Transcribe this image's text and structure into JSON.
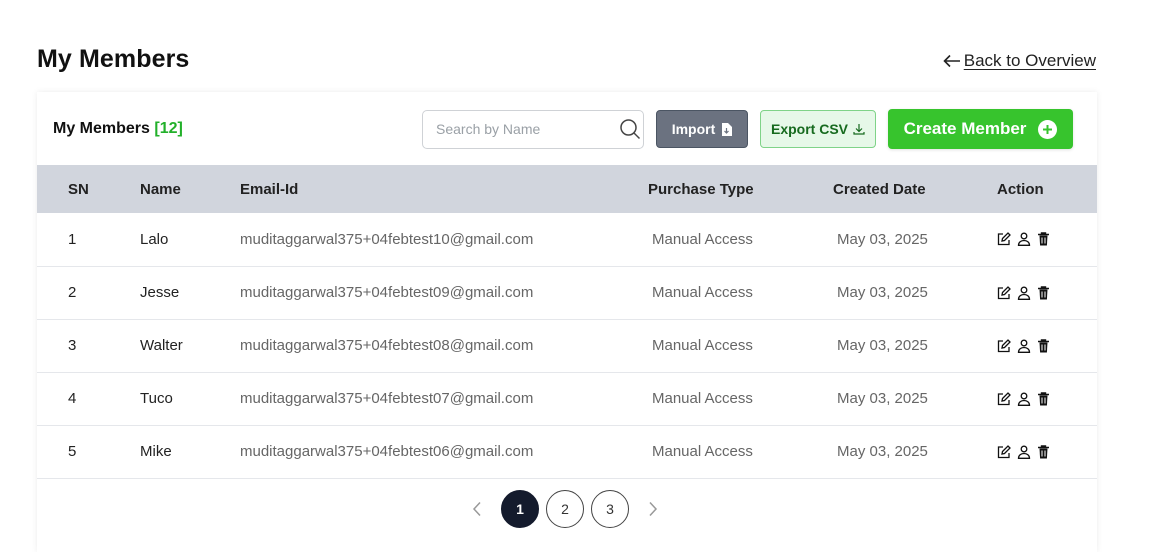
{
  "page": {
    "title": "My Members",
    "back_link": "Back to Overview"
  },
  "card": {
    "title": "My Members",
    "count": "[12]"
  },
  "toolbar": {
    "search_placeholder": "Search by Name",
    "search_value": "",
    "import_label": "Import",
    "export_label": "Export CSV",
    "create_label": "Create Member"
  },
  "table": {
    "headers": {
      "sn": "SN",
      "name": "Name",
      "email": "Email-Id",
      "purchase_type": "Purchase Type",
      "created_date": "Created Date",
      "action": "Action"
    },
    "rows": [
      {
        "sn": "1",
        "name": "Lalo",
        "email": "muditaggarwal375+04febtest10@gmail.com",
        "purchase_type": "Manual Access",
        "created_date": "May 03, 2025"
      },
      {
        "sn": "2",
        "name": "Jesse",
        "email": "muditaggarwal375+04febtest09@gmail.com",
        "purchase_type": "Manual Access",
        "created_date": "May 03, 2025"
      },
      {
        "sn": "3",
        "name": "Walter",
        "email": "muditaggarwal375+04febtest08@gmail.com",
        "purchase_type": "Manual Access",
        "created_date": "May 03, 2025"
      },
      {
        "sn": "4",
        "name": "Tuco",
        "email": "muditaggarwal375+04febtest07@gmail.com",
        "purchase_type": "Manual Access",
        "created_date": "May 03, 2025"
      },
      {
        "sn": "5",
        "name": "Mike",
        "email": "muditaggarwal375+04febtest06@gmail.com",
        "purchase_type": "Manual Access",
        "created_date": "May 03, 2025"
      }
    ]
  },
  "pagination": {
    "pages": [
      "1",
      "2",
      "3"
    ],
    "current": "1"
  },
  "colors": {
    "accent_green": "#37c42d",
    "count_green": "#22b02a",
    "header_bg": "#d1d5dd",
    "import_bg": "#6b7280",
    "export_bg": "#e6f8e8",
    "active_page": "#141b2d"
  },
  "icons": {
    "back": "arrow-left-icon",
    "search": "search-icon",
    "import": "file-icon",
    "export": "download-icon",
    "create": "plus-circle-icon",
    "edit": "edit-icon",
    "user": "user-icon",
    "delete": "trash-icon",
    "prev": "chevron-left-icon",
    "next": "chevron-right-icon"
  }
}
